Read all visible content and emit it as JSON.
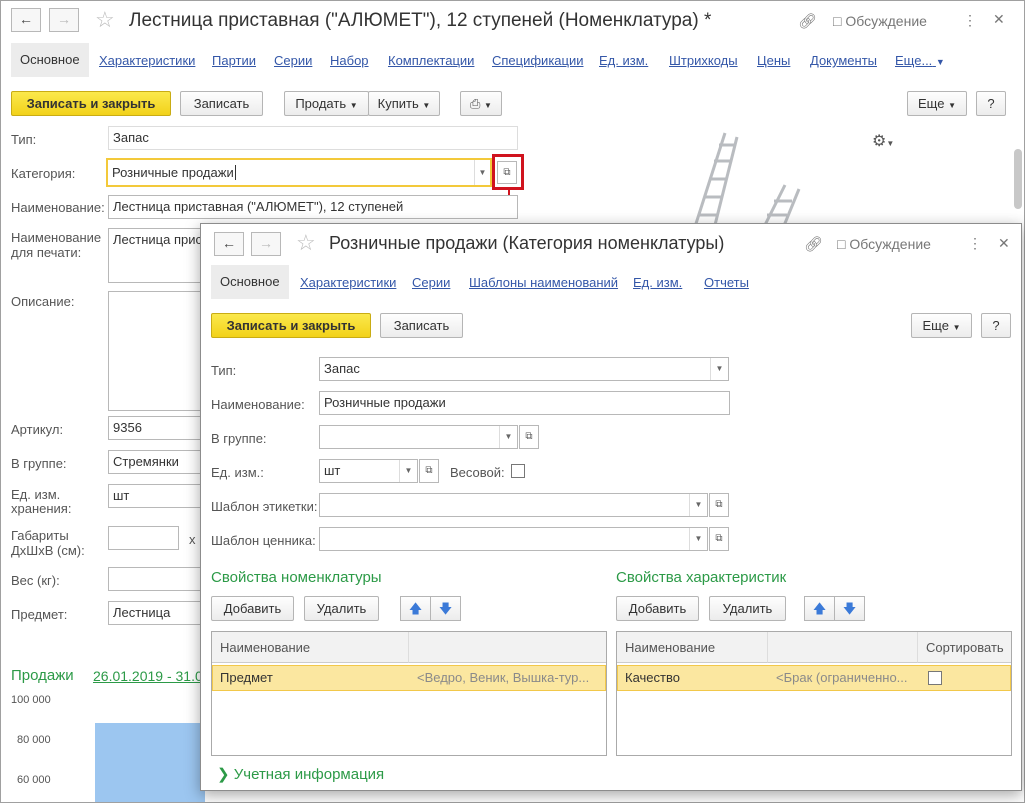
{
  "back": {
    "title": "Лестница приставная (\"АЛЮМЕТ\"), 12 ступеней (Номенклатура) *",
    "discussion": "Обсуждение",
    "tabs": [
      "Основное",
      "Характеристики",
      "Партии",
      "Серии",
      "Набор",
      "Комплектации",
      "Спецификации",
      "Ед. изм.",
      "Штрихкоды",
      "Цены",
      "Документы",
      "Еще..."
    ],
    "toolbar": {
      "save_close": "Записать и закрыть",
      "save": "Записать",
      "sell": "Продать",
      "buy": "Купить",
      "more": "Еще",
      "help": "?"
    },
    "fields": {
      "type_label": "Тип:",
      "type_value": "Запас",
      "category_label": "Категория:",
      "category_value": "Розничные продажи",
      "name_label": "Наименование:",
      "name_value": "Лестница приставная (\"АЛЮМЕТ\"), 12 ступеней",
      "print_name_label_1": "Наименование",
      "print_name_label_2": "для печати:",
      "print_name_value": "Лестница прист",
      "desc_label": "Описание:",
      "article_label": "Артикул:",
      "article_value": "9356",
      "group_label": "В группе:",
      "group_value": "Стремянки",
      "unit_label_1": "Ед. изм.",
      "unit_label_2": "хранения:",
      "unit_value": "шт",
      "dims_label_1": "Габариты",
      "dims_label_2": "ДхШхВ (см):",
      "dims_x": "x",
      "weight_label": "Вес (кг):",
      "subject_label": "Предмет:",
      "subject_value": "Лестница"
    },
    "sales": {
      "title": "Продажи",
      "period": "26.01.2019 - 31.0",
      "y_ticks": [
        "100 000",
        "80 000",
        "60 000"
      ]
    }
  },
  "front": {
    "title": "Розничные продажи (Категория номенклатуры)",
    "discussion": "Обсуждение",
    "tabs": [
      "Основное",
      "Характеристики",
      "Серии",
      "Шаблоны наименований",
      "Ед. изм.",
      "Отчеты"
    ],
    "toolbar": {
      "save_close": "Записать и закрыть",
      "save": "Записать",
      "more": "Еще",
      "help": "?"
    },
    "fields": {
      "type_label": "Тип:",
      "type_value": "Запас",
      "name_label": "Наименование:",
      "name_value": "Розничные продажи",
      "group_label": "В группе:",
      "group_value": "",
      "unit_label": "Ед. изм.:",
      "unit_value": "шт",
      "weight_label": "Весовой:",
      "label_tpl_label": "Шаблон этикетки:",
      "price_tpl_label": "Шаблон ценника:"
    },
    "props_nom": {
      "title": "Свойства номенклатуры",
      "add": "Добавить",
      "del": "Удалить",
      "col_name": "Наименование",
      "row": {
        "name": "Предмет",
        "values": "<Ведро, Веник, Вышка-тур..."
      }
    },
    "props_char": {
      "title": "Свойства характеристик",
      "add": "Добавить",
      "del": "Удалить",
      "col_name": "Наименование",
      "col_sort": "Сортировать",
      "row": {
        "name": "Качество",
        "values": "<Брак (ограниченно..."
      }
    },
    "account_info": "Учетная информация"
  }
}
